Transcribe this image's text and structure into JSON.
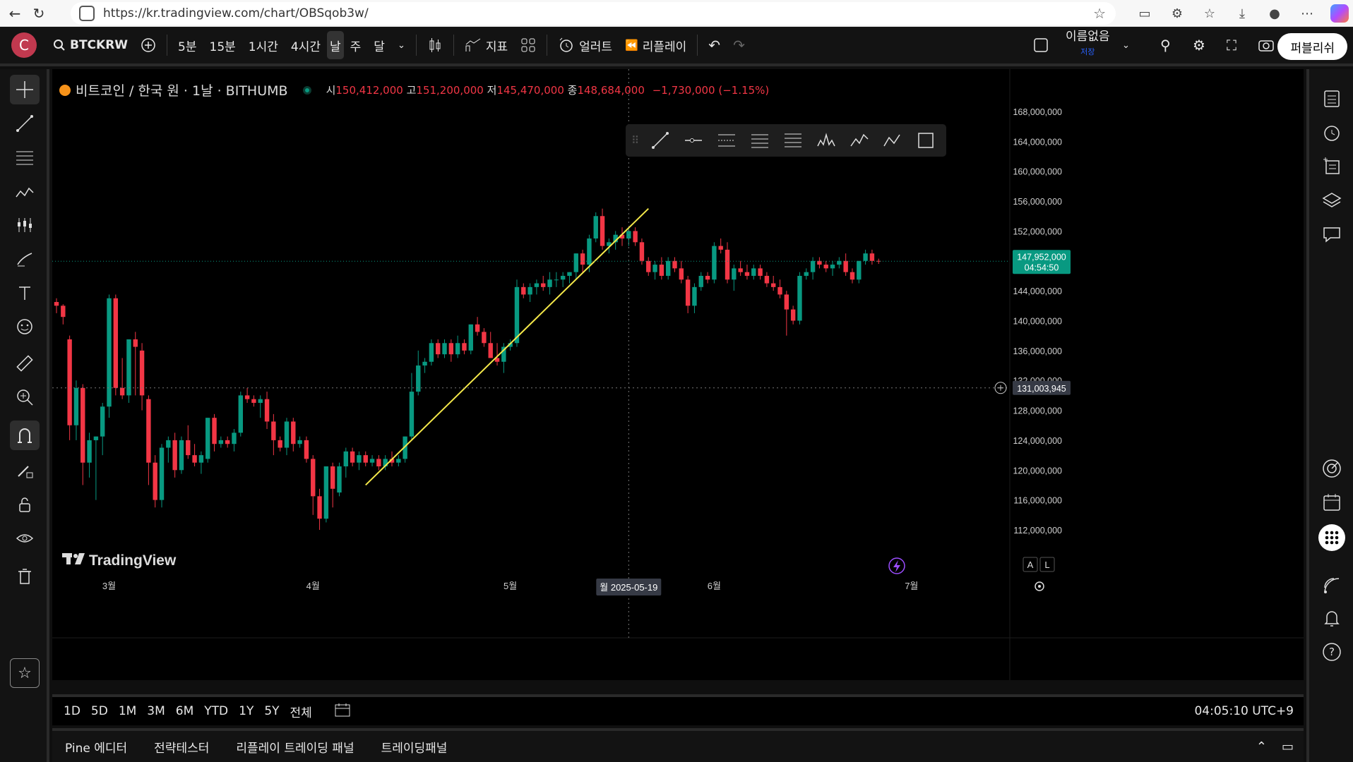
{
  "browser": {
    "url": "https://kr.tradingview.com/chart/OBSqob3w/"
  },
  "toolbar": {
    "avatar_letter": "C",
    "symbol": "BTCKRW",
    "intervals": [
      "5분",
      "15분",
      "1시간",
      "4시간",
      "날",
      "주",
      "달"
    ],
    "active_interval": "날",
    "indicators_label": "지표",
    "alerts_label": "얼러트",
    "replay_label": "리플레이",
    "layout_name": "이름없음",
    "layout_status": "저장",
    "publish_label": "퍼블리쉬"
  },
  "legend": {
    "title": "비트코인 / 한국 원 · 1날 · BITHUMB",
    "open_label": "시",
    "open": "150,412,000",
    "high_label": "고",
    "high": "151,200,000",
    "low_label": "저",
    "low": "145,470,000",
    "close_label": "종",
    "close": "148,684,000",
    "change": "−1,730,000 (−1.15%)"
  },
  "price_axis": {
    "ticks": [
      "168,000,000",
      "164,000,000",
      "160,000,000",
      "156,000,000",
      "152,000,000",
      "148,000,000",
      "144,000,000",
      "140,000,000",
      "136,000,000",
      "132,000,000",
      "128,000,000",
      "124,000,000",
      "120,000,000",
      "116,000,000",
      "112,000,000"
    ],
    "last_price": "147,952,000",
    "countdown": "04:54:50",
    "crosshair_price": "131,003,945"
  },
  "time_axis": {
    "labels": [
      "3월",
      "4월",
      "5월",
      "6월",
      "7월"
    ],
    "crosshair_date": "월 2025-05-19",
    "scale_a": "A",
    "scale_l": "L"
  },
  "watermark": "TradingView",
  "bottom": {
    "ranges": [
      "1D",
      "5D",
      "1M",
      "3M",
      "6M",
      "YTD",
      "1Y",
      "5Y",
      "전체"
    ],
    "clock": "04:05:10 UTC+9"
  },
  "panels": [
    "Pine 에디터",
    "전략테스터",
    "리플레이 트레이딩 패널",
    "트레이딩패널"
  ],
  "colors": {
    "up": "#089981",
    "down": "#f23645",
    "trendline": "#f5e94a",
    "last_price_bg": "#089981"
  },
  "chart_data": {
    "type": "candlestick",
    "x_range": [
      "2025-02-21",
      "2025-07-08"
    ],
    "y_range": [
      110000000,
      170000000
    ],
    "ohlc": [
      [
        142.5,
        143.0,
        141.0,
        142.0
      ],
      [
        142.0,
        142.2,
        139.5,
        140.5
      ],
      [
        137.5,
        138.0,
        124.0,
        126.0
      ],
      [
        126.0,
        132.0,
        124.0,
        131.0
      ],
      [
        131.0,
        131.5,
        118.0,
        121.0
      ],
      [
        121.0,
        125.0,
        119.0,
        124.0
      ],
      [
        124.0,
        124.5,
        116.0,
        124.5
      ],
      [
        124.5,
        129.0,
        122.0,
        128.5
      ],
      [
        128.5,
        143.5,
        127.0,
        143.0
      ],
      [
        143.0,
        143.5,
        130.0,
        131.0
      ],
      [
        131.0,
        135.0,
        129.5,
        130.0
      ],
      [
        130.0,
        137.5,
        129.0,
        137.5
      ],
      [
        137.5,
        138.5,
        130.0,
        136.5
      ],
      [
        136.0,
        137.0,
        128.0,
        130.0
      ],
      [
        129.5,
        130.0,
        118.0,
        121.0
      ],
      [
        121.0,
        122.0,
        115.0,
        116.0
      ],
      [
        116.0,
        123.5,
        115.0,
        123.0
      ],
      [
        123.0,
        124.5,
        121.0,
        124.0
      ],
      [
        124.0,
        125.0,
        119.0,
        120.0
      ],
      [
        120.0,
        124.5,
        119.5,
        124.0
      ],
      [
        124.0,
        126.0,
        121.5,
        122.0
      ],
      [
        122.0,
        123.5,
        120.5,
        121.0
      ],
      [
        121.0,
        122.5,
        119.5,
        122.0
      ],
      [
        121.5,
        127.0,
        121.0,
        127.0
      ],
      [
        127.0,
        127.5,
        122.5,
        123.5
      ],
      [
        123.5,
        124.5,
        123.0,
        124.0
      ],
      [
        124.0,
        124.5,
        123.0,
        123.5
      ],
      [
        123.5,
        125.5,
        122.5,
        125.0
      ],
      [
        125.0,
        130.5,
        124.5,
        130.0
      ],
      [
        130.0,
        131.0,
        129.0,
        129.5
      ],
      [
        129.5,
        130.0,
        128.5,
        129.0
      ],
      [
        129.0,
        130.0,
        127.0,
        129.5
      ],
      [
        129.5,
        130.5,
        125.5,
        126.5
      ],
      [
        126.5,
        127.5,
        122.0,
        124.0
      ],
      [
        124.0,
        124.5,
        122.5,
        123.0
      ],
      [
        123.0,
        127.0,
        122.0,
        126.5
      ],
      [
        126.5,
        127.0,
        122.5,
        123.5
      ],
      [
        123.5,
        124.5,
        123.0,
        124.0
      ],
      [
        124.0,
        124.5,
        121.0,
        121.5
      ],
      [
        121.5,
        122.0,
        114.0,
        116.5
      ],
      [
        116.5,
        117.5,
        112.0,
        113.5
      ],
      [
        113.5,
        120.5,
        113.0,
        120.5
      ],
      [
        120.5,
        121.0,
        115.0,
        117.5
      ],
      [
        117.0,
        121.0,
        116.5,
        120.5
      ],
      [
        120.5,
        123.0,
        119.0,
        122.5
      ],
      [
        122.5,
        123.0,
        120.5,
        121.0
      ],
      [
        121.0,
        122.5,
        120.0,
        122.0
      ],
      [
        122.0,
        122.5,
        120.5,
        121.0
      ],
      [
        121.0,
        122.0,
        120.5,
        121.5
      ],
      [
        121.5,
        122.0,
        120.0,
        120.5
      ],
      [
        120.5,
        122.0,
        120.0,
        121.5
      ],
      [
        121.5,
        122.5,
        120.5,
        121.0
      ],
      [
        121.0,
        122.0,
        120.5,
        121.5
      ],
      [
        121.5,
        124.5,
        121.0,
        124.5
      ],
      [
        124.5,
        133.0,
        124.0,
        130.5
      ],
      [
        130.5,
        136.0,
        130.0,
        134.0
      ],
      [
        134.0,
        135.0,
        133.0,
        134.5
      ],
      [
        134.5,
        137.5,
        134.0,
        137.0
      ],
      [
        137.0,
        137.5,
        135.0,
        135.5
      ],
      [
        135.5,
        137.5,
        135.0,
        137.0
      ],
      [
        137.0,
        137.5,
        134.5,
        135.5
      ],
      [
        135.5,
        138.0,
        135.0,
        137.0
      ],
      [
        137.0,
        137.5,
        135.5,
        136.0
      ],
      [
        136.0,
        139.5,
        135.5,
        139.5
      ],
      [
        139.5,
        140.5,
        138.0,
        138.5
      ],
      [
        138.5,
        139.0,
        136.5,
        137.0
      ],
      [
        137.0,
        138.5,
        135.0,
        135.0
      ],
      [
        135.0,
        137.0,
        134.0,
        134.5
      ],
      [
        134.5,
        137.0,
        133.0,
        136.5
      ],
      [
        136.5,
        137.5,
        136.0,
        137.0
      ],
      [
        137.0,
        145.5,
        136.5,
        144.5
      ],
      [
        144.5,
        145.0,
        143.0,
        143.5
      ],
      [
        143.5,
        145.0,
        142.5,
        144.5
      ],
      [
        144.5,
        145.5,
        143.5,
        145.0
      ],
      [
        145.0,
        146.0,
        144.0,
        144.5
      ],
      [
        144.5,
        146.5,
        143.5,
        145.5
      ],
      [
        145.5,
        146.5,
        144.5,
        145.5
      ],
      [
        145.5,
        146.5,
        144.5,
        146.0
      ],
      [
        146.0,
        146.5,
        145.0,
        146.5
      ],
      [
        146.5,
        149.0,
        145.5,
        149.0
      ],
      [
        149.0,
        149.5,
        146.5,
        147.5
      ],
      [
        147.5,
        151.5,
        146.5,
        151.0
      ],
      [
        151.0,
        154.5,
        150.5,
        154.0
      ],
      [
        154.0,
        155.0,
        149.5,
        150.0
      ],
      [
        150.0,
        151.0,
        149.0,
        150.5
      ],
      [
        150.5,
        152.0,
        149.5,
        151.5
      ],
      [
        151.5,
        152.5,
        150.0,
        151.0
      ],
      [
        151.0,
        152.5,
        150.0,
        152.0
      ],
      [
        152.0,
        152.5,
        150.0,
        150.5
      ],
      [
        150.5,
        151.0,
        147.5,
        148.0
      ],
      [
        148.0,
        148.5,
        146.0,
        146.5
      ],
      [
        146.5,
        148.0,
        145.5,
        147.5
      ],
      [
        147.5,
        148.5,
        145.5,
        146.0
      ],
      [
        146.0,
        148.5,
        145.5,
        148.0
      ],
      [
        148.0,
        148.5,
        146.5,
        147.0
      ],
      [
        147.0,
        148.0,
        145.0,
        145.5
      ],
      [
        145.5,
        146.0,
        141.0,
        142.0
      ],
      [
        142.0,
        145.0,
        141.0,
        144.5
      ],
      [
        144.5,
        146.5,
        144.0,
        146.0
      ],
      [
        146.0,
        146.5,
        145.0,
        145.5
      ],
      [
        145.5,
        150.5,
        145.0,
        150.0
      ],
      [
        150.0,
        151.0,
        149.0,
        149.5
      ],
      [
        149.5,
        150.5,
        145.0,
        145.5
      ],
      [
        145.5,
        147.5,
        144.0,
        147.0
      ],
      [
        147.0,
        148.0,
        146.0,
        146.5
      ],
      [
        146.5,
        147.5,
        145.5,
        146.0
      ],
      [
        146.0,
        147.5,
        145.5,
        147.0
      ],
      [
        147.0,
        147.5,
        145.5,
        146.0
      ],
      [
        146.0,
        146.5,
        144.5,
        145.0
      ],
      [
        145.0,
        146.0,
        144.0,
        144.5
      ],
      [
        144.5,
        145.5,
        143.0,
        143.5
      ],
      [
        143.5,
        144.0,
        138.0,
        141.5
      ],
      [
        141.5,
        142.0,
        139.5,
        140.0
      ],
      [
        140.0,
        146.5,
        139.5,
        146.0
      ],
      [
        146.0,
        147.0,
        145.5,
        146.5
      ],
      [
        146.5,
        148.5,
        145.5,
        148.0
      ],
      [
        148.0,
        148.5,
        147.0,
        147.5
      ],
      [
        147.5,
        148.0,
        146.5,
        147.0
      ],
      [
        147.0,
        148.0,
        146.0,
        147.5
      ],
      [
        147.5,
        148.5,
        147.0,
        148.0
      ],
      [
        148.0,
        149.0,
        146.0,
        146.5
      ],
      [
        146.5,
        147.0,
        145.0,
        145.5
      ],
      [
        145.5,
        148.0,
        145.0,
        148.0
      ],
      [
        148.0,
        149.5,
        147.5,
        149.0
      ],
      [
        149.0,
        149.5,
        147.5,
        148.0
      ],
      [
        148.0,
        148.3,
        147.6,
        147.95
      ]
    ],
    "trendline": [
      [
        "2025-04-09",
        118000000
      ],
      [
        "2025-05-22",
        155000000
      ]
    ],
    "crosshair": {
      "x": "2025-05-19",
      "y": 131003945
    }
  }
}
